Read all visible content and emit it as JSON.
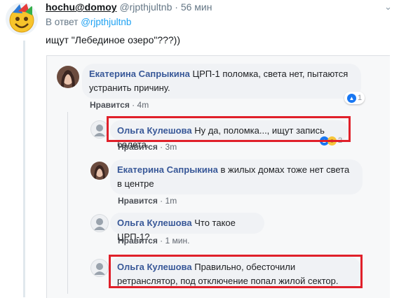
{
  "tweet": {
    "display_name": "hochu@domoy",
    "handle": "@rjpthjultnb",
    "separator": "·",
    "time": "56 мин",
    "reply_prefix": "В ответ",
    "reply_to": "@rjpthjultnb",
    "text": "ищут \"Лебединое озеро\"???))",
    "more_icon": "chevron-down-icon"
  },
  "fb": {
    "comments": [
      {
        "author": "Екатерина Сапрыкина",
        "text": "ЦРП-1 поломка, света нет, пытаются устранить причину.",
        "like": "Нравится",
        "time": "4m",
        "reactions": "1"
      },
      {
        "author": "Ольга Кулешова",
        "text": "Ну да, поломка..., ищут запись балета.",
        "like": "Нравится",
        "time": "3m",
        "reactions": "2"
      },
      {
        "author": "Екатерина Сапрыкина",
        "text": "в жилых домах тоже нет света в центре",
        "like": "Нравится",
        "time": "1m"
      },
      {
        "author": "Ольга Кулешова",
        "text": "Что такое ЦРП-1?",
        "like": "Нравится",
        "time": "1 мин."
      },
      {
        "author": "Ольга Кулешова",
        "text": "Правильно, обесточили ретранслятор, под отключение попал жилой сектор."
      }
    ],
    "dot": "·"
  },
  "colors": {
    "highlight": "#e0202a",
    "fb_link": "#385898",
    "twitter_blue": "#1da1f2"
  }
}
